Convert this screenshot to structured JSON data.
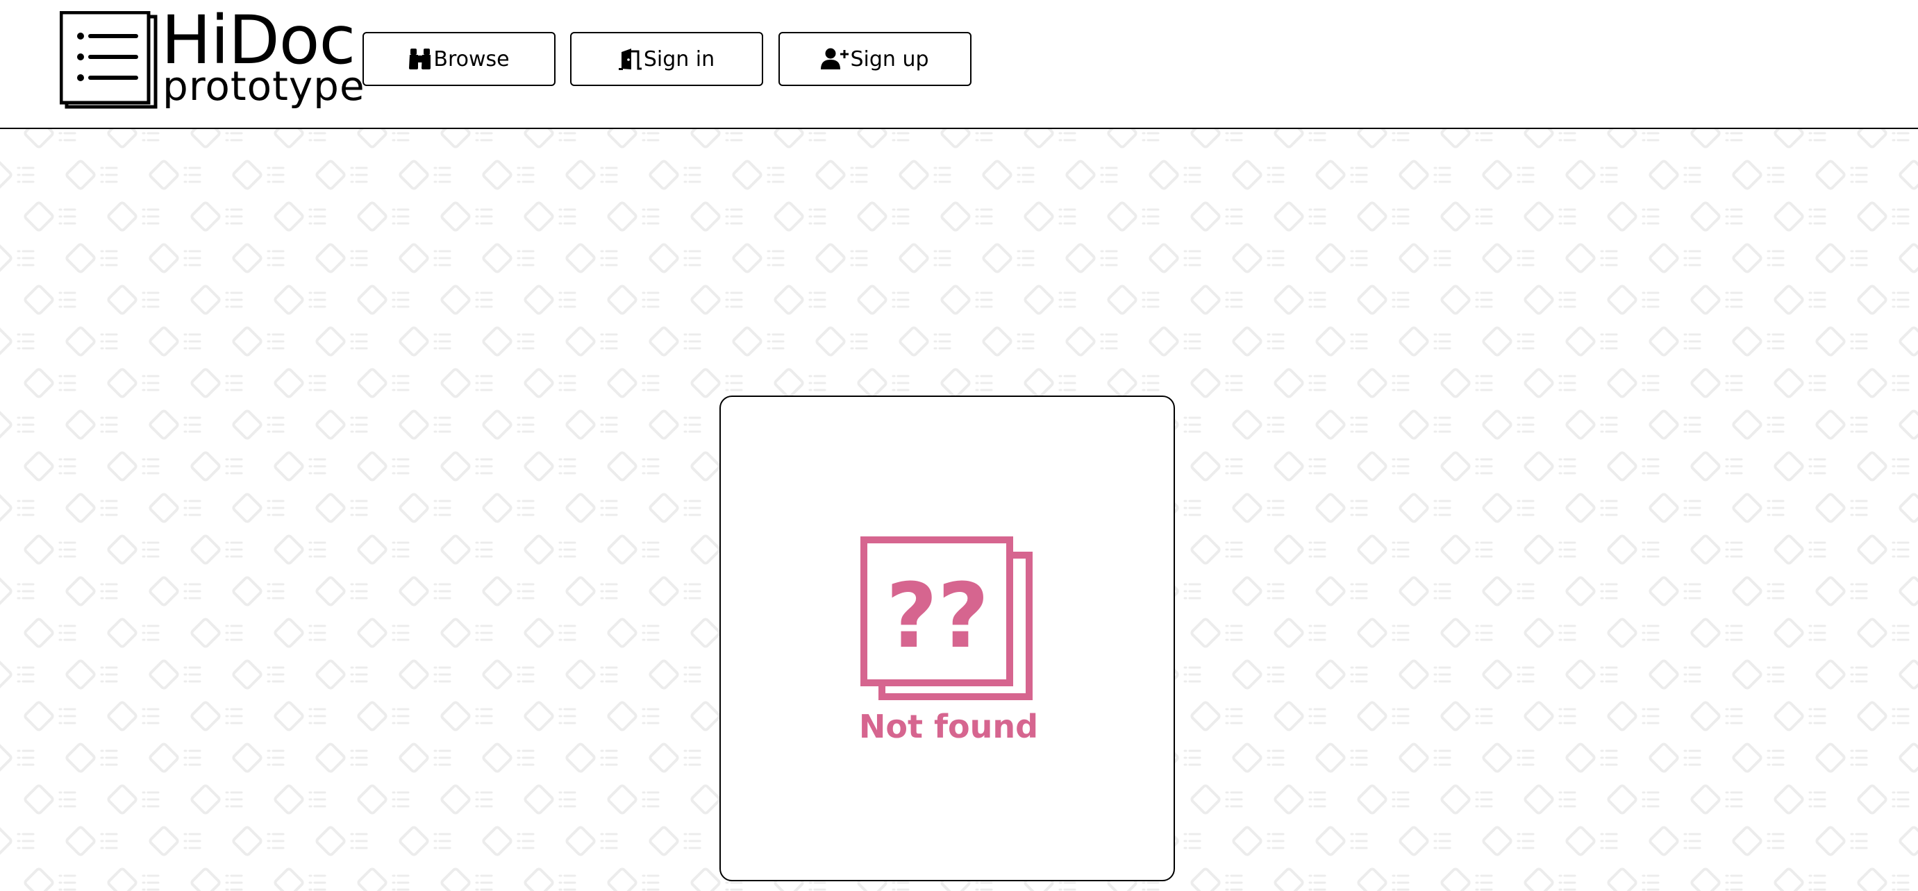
{
  "header": {
    "logo": {
      "title": "HiDoc",
      "subtitle": "prototype",
      "icon": "document-list-icon"
    },
    "nav": [
      {
        "label": "Browse",
        "icon": "binoculars-icon"
      },
      {
        "label": "Sign in",
        "icon": "door-enter-icon"
      },
      {
        "label": "Sign up",
        "icon": "user-plus-icon"
      }
    ]
  },
  "main": {
    "status": {
      "message": "Not found",
      "icon": "question-documents-icon",
      "icon_glyph": "??",
      "color": "#d6658f"
    }
  },
  "colors": {
    "accent": "#d6658f",
    "border": "#000000",
    "pattern": "#ededed"
  }
}
